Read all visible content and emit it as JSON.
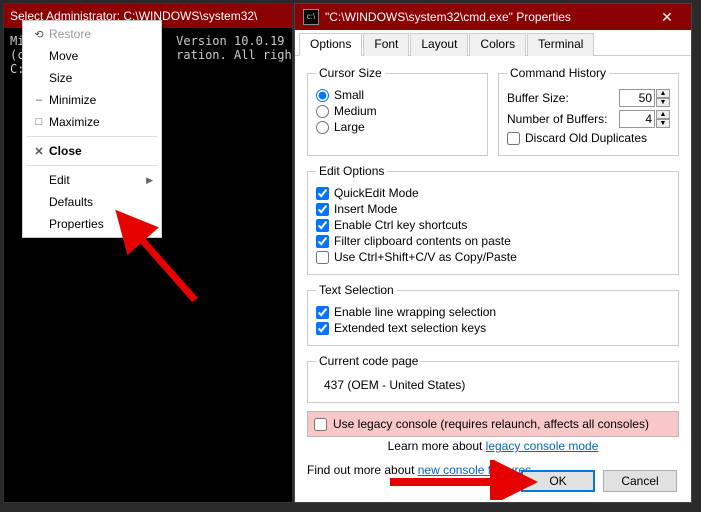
{
  "console": {
    "title": "Select Administrator: C:\\WINDOWS\\system32\\",
    "lines": [
      "Mi                     Version 10.0.19",
      "(c                     ration. All righ",
      "",
      "C:"
    ]
  },
  "contextMenu": {
    "items": [
      {
        "icon": "⟲",
        "label": "Restore",
        "disabled": true
      },
      {
        "icon": "",
        "label": "Move"
      },
      {
        "icon": "",
        "label": "Size"
      },
      {
        "icon": "–",
        "label": "Minimize"
      },
      {
        "icon": "□",
        "label": "Maximize"
      },
      {
        "sep": true
      },
      {
        "icon": "✕",
        "label": "Close",
        "bold": true
      },
      {
        "sep": true
      },
      {
        "icon": "",
        "label": "Edit",
        "submenu": true
      },
      {
        "icon": "",
        "label": "Defaults"
      },
      {
        "icon": "",
        "label": "Properties"
      }
    ]
  },
  "dialog": {
    "title": "\"C:\\WINDOWS\\system32\\cmd.exe\" Properties",
    "tabs": [
      "Options",
      "Font",
      "Layout",
      "Colors",
      "Terminal"
    ],
    "activeTab": 0,
    "cursorSize": {
      "legend": "Cursor Size",
      "options": [
        "Small",
        "Medium",
        "Large"
      ],
      "selected": 0
    },
    "commandHistory": {
      "legend": "Command History",
      "bufferLabel": "Buffer Size:",
      "bufferValue": "50",
      "numLabel": "Number of Buffers:",
      "numValue": "4",
      "discard": "Discard Old Duplicates"
    },
    "editOptions": {
      "legend": "Edit Options",
      "items": [
        {
          "label": "QuickEdit Mode",
          "checked": true
        },
        {
          "label": "Insert Mode",
          "checked": true
        },
        {
          "label": "Enable Ctrl key shortcuts",
          "checked": true
        },
        {
          "label": "Filter clipboard contents on paste",
          "checked": true
        },
        {
          "label": "Use Ctrl+Shift+C/V as Copy/Paste",
          "checked": false
        }
      ]
    },
    "textSelection": {
      "legend": "Text Selection",
      "items": [
        {
          "label": "Enable line wrapping selection",
          "checked": true
        },
        {
          "label": "Extended text selection keys",
          "checked": true
        }
      ]
    },
    "codepage": {
      "legend": "Current code page",
      "value": "437  (OEM - United States)"
    },
    "legacy": {
      "label": "Use legacy console (requires relaunch, affects all consoles)",
      "learnPrefix": "Learn more about ",
      "learnLink": "legacy console mode"
    },
    "findout": {
      "prefix": "Find out more about ",
      "link": "new console features"
    },
    "buttons": {
      "ok": "OK",
      "cancel": "Cancel"
    }
  }
}
